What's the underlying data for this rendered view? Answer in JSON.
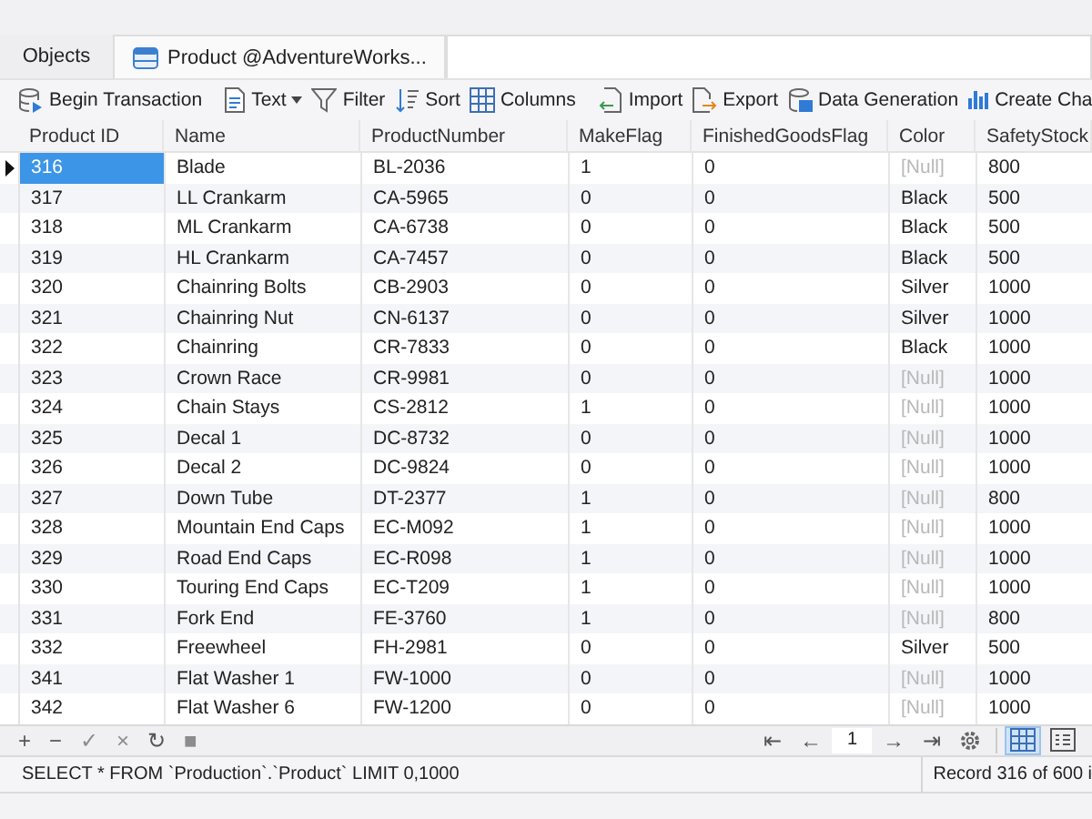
{
  "tabs": [
    {
      "label": "Objects",
      "selected": false,
      "icon": false
    },
    {
      "label": "Product @AdventureWorks...",
      "selected": true,
      "icon": true
    }
  ],
  "toolbar": [
    {
      "kind": "transaction",
      "label": "Begin Transaction",
      "dropdown": false
    },
    {
      "kind": "text",
      "label": "Text",
      "dropdown": true
    },
    {
      "kind": "filter",
      "label": "Filter",
      "dropdown": false
    },
    {
      "kind": "sort",
      "label": "Sort",
      "dropdown": false
    },
    {
      "kind": "columns",
      "label": "Columns",
      "dropdown": false
    },
    {
      "kind": "import",
      "label": "Import",
      "dropdown": false
    },
    {
      "kind": "export",
      "label": "Export",
      "dropdown": false
    },
    {
      "kind": "generation",
      "label": "Data Generation",
      "dropdown": false
    },
    {
      "kind": "chart",
      "label": "Create Cha",
      "dropdown": false
    }
  ],
  "table": {
    "columns": [
      "Product ID",
      "Name",
      "ProductNumber",
      "MakeFlag",
      "FinishedGoodsFlag",
      "Color",
      "SafetyStock"
    ],
    "rows": [
      {
        "selected": true,
        "cells": [
          "316",
          "Blade",
          "BL-2036",
          "1",
          "0"
        ],
        "color": {
          "text": "[Null]",
          "null": true
        },
        "safety_stock": "800"
      },
      {
        "selected": false,
        "cells": [
          "317",
          "LL Crankarm",
          "CA-5965",
          "0",
          "0"
        ],
        "color": {
          "text": "Black",
          "null": false
        },
        "safety_stock": "500"
      },
      {
        "selected": false,
        "cells": [
          "318",
          "ML Crankarm",
          "CA-6738",
          "0",
          "0"
        ],
        "color": {
          "text": "Black",
          "null": false
        },
        "safety_stock": "500"
      },
      {
        "selected": false,
        "cells": [
          "319",
          "HL Crankarm",
          "CA-7457",
          "0",
          "0"
        ],
        "color": {
          "text": "Black",
          "null": false
        },
        "safety_stock": "500"
      },
      {
        "selected": false,
        "cells": [
          "320",
          "Chainring Bolts",
          "CB-2903",
          "0",
          "0"
        ],
        "color": {
          "text": "Silver",
          "null": false
        },
        "safety_stock": "1000"
      },
      {
        "selected": false,
        "cells": [
          "321",
          "Chainring Nut",
          "CN-6137",
          "0",
          "0"
        ],
        "color": {
          "text": "Silver",
          "null": false
        },
        "safety_stock": "1000"
      },
      {
        "selected": false,
        "cells": [
          "322",
          "Chainring",
          "CR-7833",
          "0",
          "0"
        ],
        "color": {
          "text": "Black",
          "null": false
        },
        "safety_stock": "1000"
      },
      {
        "selected": false,
        "cells": [
          "323",
          "Crown Race",
          "CR-9981",
          "0",
          "0"
        ],
        "color": {
          "text": "[Null]",
          "null": true
        },
        "safety_stock": "1000"
      },
      {
        "selected": false,
        "cells": [
          "324",
          "Chain Stays",
          "CS-2812",
          "1",
          "0"
        ],
        "color": {
          "text": "[Null]",
          "null": true
        },
        "safety_stock": "1000"
      },
      {
        "selected": false,
        "cells": [
          "325",
          "Decal 1",
          "DC-8732",
          "0",
          "0"
        ],
        "color": {
          "text": "[Null]",
          "null": true
        },
        "safety_stock": "1000"
      },
      {
        "selected": false,
        "cells": [
          "326",
          "Decal 2",
          "DC-9824",
          "0",
          "0"
        ],
        "color": {
          "text": "[Null]",
          "null": true
        },
        "safety_stock": "1000"
      },
      {
        "selected": false,
        "cells": [
          "327",
          "Down Tube",
          "DT-2377",
          "1",
          "0"
        ],
        "color": {
          "text": "[Null]",
          "null": true
        },
        "safety_stock": "800"
      },
      {
        "selected": false,
        "cells": [
          "328",
          "Mountain End Caps",
          "EC-M092",
          "1",
          "0"
        ],
        "color": {
          "text": "[Null]",
          "null": true
        },
        "safety_stock": "1000"
      },
      {
        "selected": false,
        "cells": [
          "329",
          "Road End Caps",
          "EC-R098",
          "1",
          "0"
        ],
        "color": {
          "text": "[Null]",
          "null": true
        },
        "safety_stock": "1000"
      },
      {
        "selected": false,
        "cells": [
          "330",
          "Touring End Caps",
          "EC-T209",
          "1",
          "0"
        ],
        "color": {
          "text": "[Null]",
          "null": true
        },
        "safety_stock": "1000"
      },
      {
        "selected": false,
        "cells": [
          "331",
          "Fork End",
          "FE-3760",
          "1",
          "0"
        ],
        "color": {
          "text": "[Null]",
          "null": true
        },
        "safety_stock": "800"
      },
      {
        "selected": false,
        "cells": [
          "332",
          "Freewheel",
          "FH-2981",
          "0",
          "0"
        ],
        "color": {
          "text": "Silver",
          "null": false
        },
        "safety_stock": "500"
      },
      {
        "selected": false,
        "cells": [
          "341",
          "Flat Washer 1",
          "FW-1000",
          "0",
          "0"
        ],
        "color": {
          "text": "[Null]",
          "null": true
        },
        "safety_stock": "1000"
      },
      {
        "selected": false,
        "cells": [
          "342",
          "Flat Washer 6",
          "FW-1200",
          "0",
          "0"
        ],
        "color": {
          "text": "[Null]",
          "null": true
        },
        "safety_stock": "1000"
      }
    ]
  },
  "footer": {
    "edit_buttons": [
      {
        "glyph": "+",
        "disabled": false
      },
      {
        "glyph": "−",
        "disabled": false
      },
      {
        "glyph": "✓",
        "disabled": true
      },
      {
        "glyph": "×",
        "disabled": true
      },
      {
        "glyph": "↻",
        "disabled": false
      },
      {
        "glyph": "■",
        "disabled": true
      }
    ],
    "pager_back": [
      "⇤",
      "←"
    ],
    "page": "1",
    "pager_forward": [
      "→",
      "⇥"
    ],
    "views": [
      {
        "kind": "grid",
        "selected": true
      },
      {
        "kind": "form",
        "selected": false
      }
    ]
  },
  "status_bar": {
    "query": "SELECT * FROM `Production`.`Product` LIMIT 0,1000",
    "record": "Record 316 of 600 i"
  }
}
